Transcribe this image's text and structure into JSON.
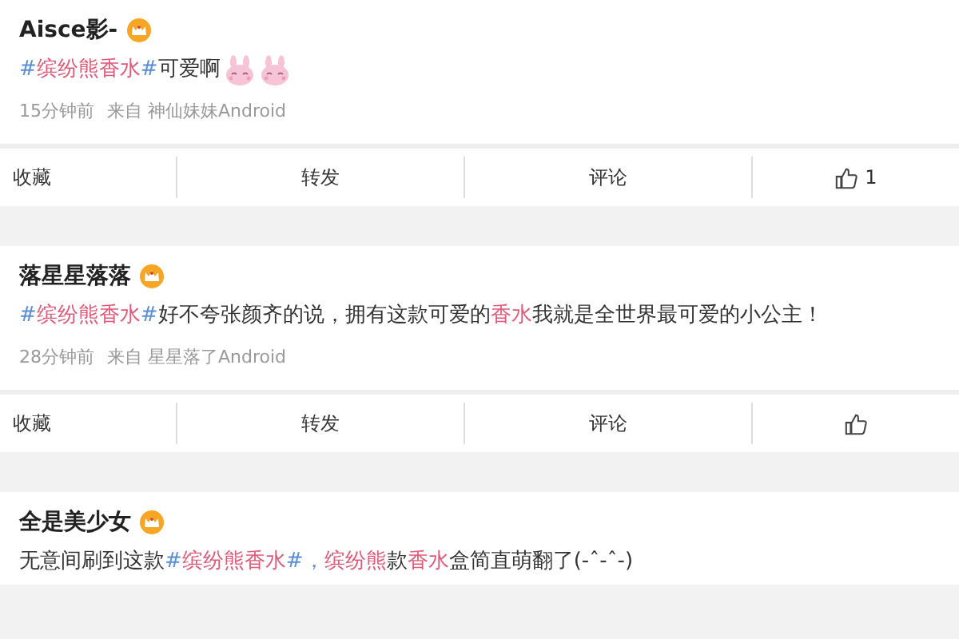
{
  "posts": [
    {
      "author": "Aisce影-",
      "body": [
        {
          "kind": "hashmark",
          "text": "#"
        },
        {
          "kind": "keyword",
          "text": "缤纷熊香水"
        },
        {
          "kind": "hashmark",
          "text": "#"
        },
        {
          "kind": "plain",
          "text": "可爱啊"
        },
        {
          "kind": "bunny"
        },
        {
          "kind": "bunny"
        }
      ],
      "time": "15分钟前",
      "source": "来自 神仙妹妹Android",
      "actions": {
        "favorite": "收藏",
        "repost": "转发",
        "comment": "评论",
        "likes": "1"
      }
    },
    {
      "author": "落星星落落",
      "body": [
        {
          "kind": "hashmark",
          "text": "#"
        },
        {
          "kind": "keyword",
          "text": "缤纷熊香水"
        },
        {
          "kind": "hashmark",
          "text": "#"
        },
        {
          "kind": "plain",
          "text": "好不夸张颜齐的说，拥有这款可爱的"
        },
        {
          "kind": "keyword",
          "text": "香水"
        },
        {
          "kind": "plain",
          "text": "我就是全世界最可爱的小公主！"
        }
      ],
      "time": "28分钟前",
      "source": "来自 星星落了Android",
      "actions": {
        "favorite": "收藏",
        "repost": "转发",
        "comment": "评论"
      }
    },
    {
      "author": "全是美少女",
      "body": [
        {
          "kind": "plain",
          "text": "无意间刷到这款"
        },
        {
          "kind": "hashmark",
          "text": "#"
        },
        {
          "kind": "keyword",
          "text": "缤纷熊香水"
        },
        {
          "kind": "hashmark",
          "text": "#，"
        },
        {
          "kind": "keyword",
          "text": "缤纷熊"
        },
        {
          "kind": "plain",
          "text": "款"
        },
        {
          "kind": "keyword",
          "text": "香水"
        },
        {
          "kind": "plain",
          "text": "盒简直萌翻了(-ˆ-ˆ-)"
        }
      ]
    }
  ]
}
